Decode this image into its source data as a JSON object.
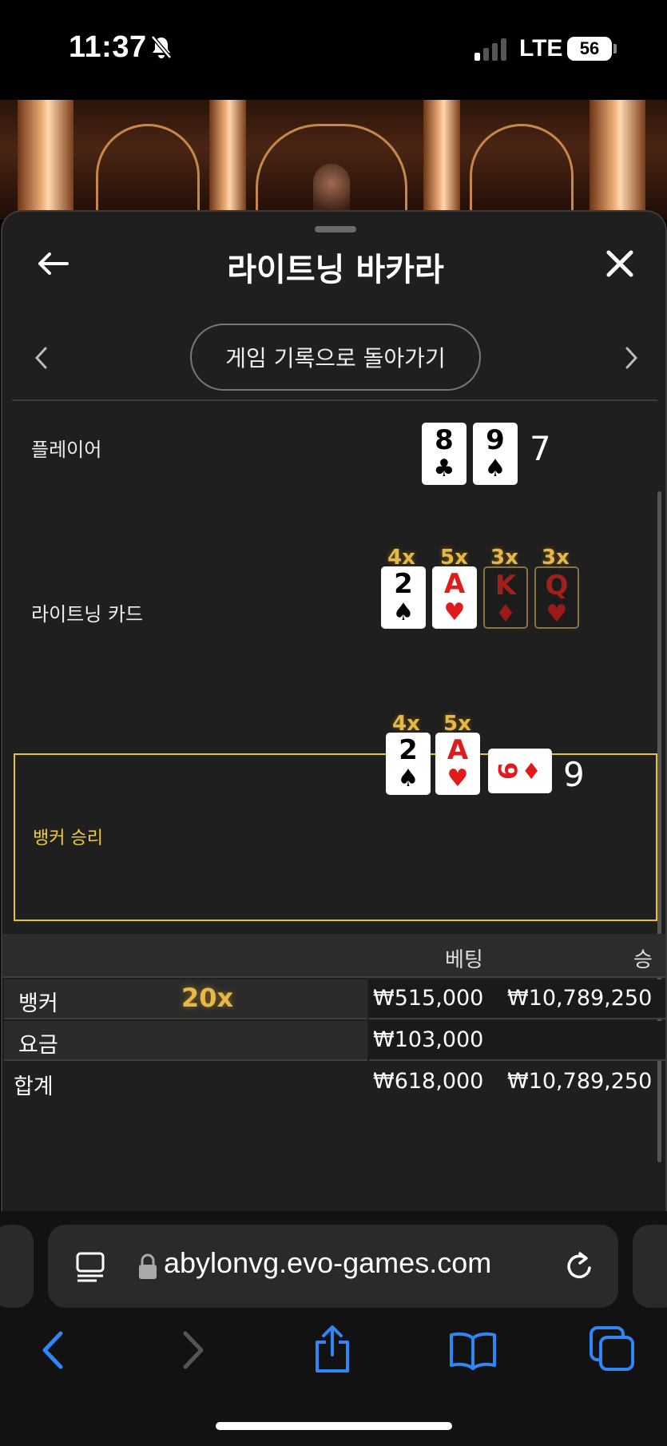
{
  "status_bar": {
    "time": "11:37",
    "network": "LTE",
    "battery": "56"
  },
  "header": {
    "title": "라이트닝 바카라",
    "back_icon": "arrow-left-icon",
    "close_icon": "close-icon"
  },
  "nav": {
    "history_button": "게임 기록으로 돌아가기"
  },
  "rows": {
    "player": {
      "label": "플레이어",
      "score": "7",
      "cards": [
        {
          "rank": "8",
          "suit": "♣"
        },
        {
          "rank": "9",
          "suit": "♠"
        }
      ]
    },
    "lightning": {
      "label": "라이트닝 카드",
      "cards": [
        {
          "mult": "4x",
          "rank": "2",
          "suit": "♠"
        },
        {
          "mult": "5x",
          "rank": "A",
          "suit": "♥"
        },
        {
          "mult": "3x",
          "rank": "K",
          "suit": "♦"
        },
        {
          "mult": "3x",
          "rank": "Q",
          "suit": "♥"
        }
      ]
    },
    "banker": {
      "label": "뱅커 승리",
      "score": "9",
      "cards": [
        {
          "mult": "4x",
          "rank": "2",
          "suit": "♠"
        },
        {
          "mult": "5x",
          "rank": "A",
          "suit": "♥"
        },
        {
          "rank": "9",
          "suit": "♦"
        }
      ]
    }
  },
  "table": {
    "headers": {
      "bet": "베팅",
      "win": "승"
    },
    "rows": [
      {
        "name": "뱅커",
        "mult": "20x",
        "bet": "₩515,000",
        "win": "₩10,789,250"
      },
      {
        "name": "요금",
        "bet": "₩103,000",
        "win": ""
      },
      {
        "name": "합계",
        "bet": "₩618,000",
        "win": "₩10,789,250"
      }
    ]
  },
  "browser": {
    "url": "abylonvg.evo-games.com"
  },
  "colors": {
    "accent_gold": "#e8c42a",
    "multiplier": "#e6b84a",
    "red_suit": "#e01b1b",
    "ios_blue": "#2f86f7"
  }
}
